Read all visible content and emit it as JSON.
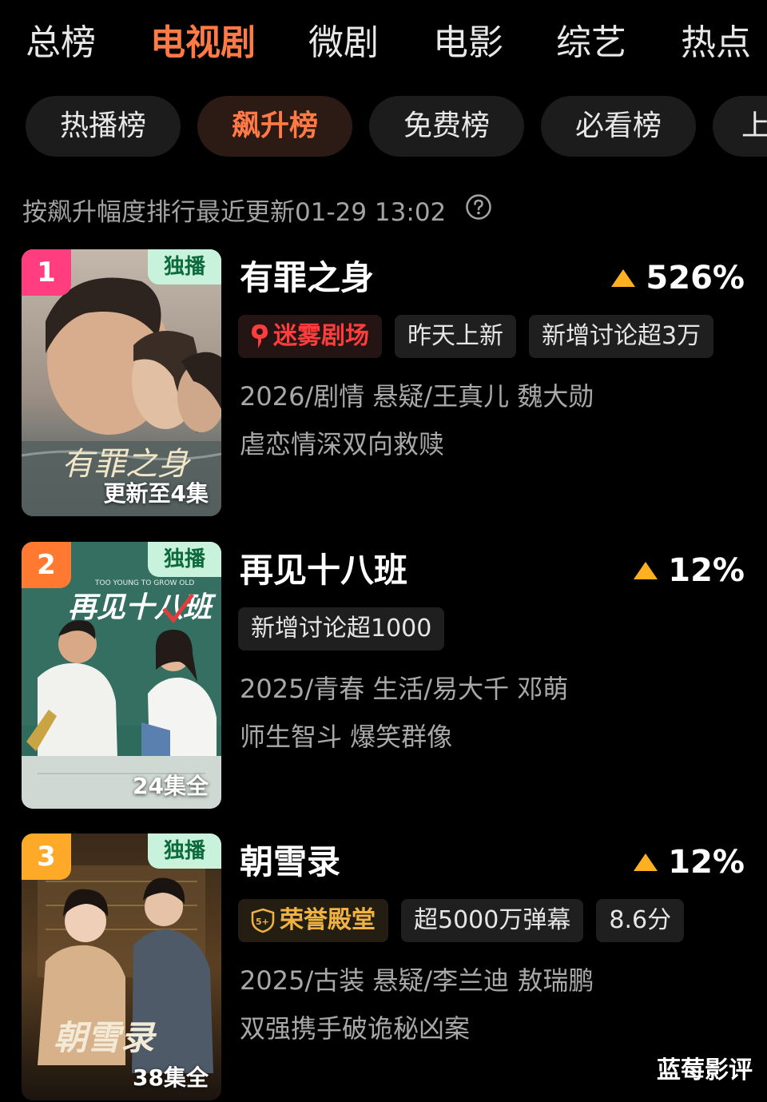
{
  "top_tabs": [
    "总榜",
    "电视剧",
    "微剧",
    "电影",
    "综艺",
    "热点"
  ],
  "active_top_tab": "电视剧",
  "sub_tabs": [
    "热播榜",
    "飙升榜",
    "免费榜",
    "必看榜",
    "上"
  ],
  "active_sub_tab": "飙升榜",
  "hint": "按飙升幅度排行最近更新01-29 13:02",
  "colors": {
    "accent": "#ff7a45",
    "trend_up": "#ffb020",
    "rank1": "#ff3d7f",
    "rank2": "#ff7a30",
    "rank3": "#ffa928",
    "exclusive_bg": "#c9f2dc"
  },
  "items": [
    {
      "rank": "1",
      "exclusive": "独播",
      "episodes": "更新至4集",
      "title": "有罪之身",
      "trend": "526%",
      "tags": [
        "迷雾剧场",
        "昨天上新",
        "新增讨论超3万"
      ],
      "meta": "2026/剧情 悬疑/王真儿 魏大勋",
      "slogan": "虐恋情深双向救赎",
      "poster_text": "有罪之身"
    },
    {
      "rank": "2",
      "exclusive": "独播",
      "episodes": "24集全",
      "title": "再见十八班",
      "trend": "12%",
      "tags": [
        "新增讨论超1000"
      ],
      "meta": "2025/青春 生活/易大千 邓萌",
      "slogan": "师生智斗 爆笑群像",
      "poster_text": "再见十八班",
      "poster_subtext": "TOO YOUNG TO GROW OLD"
    },
    {
      "rank": "3",
      "exclusive": "独播",
      "episodes": "38集全",
      "title": "朝雪录",
      "trend": "12%",
      "tags": [
        "荣誉殿堂",
        "超5000万弹幕",
        "8.6分"
      ],
      "meta": "2025/古装 悬疑/李兰迪 敖瑞鹏",
      "slogan": "双强携手破诡秘凶案",
      "poster_text": "朝雪录"
    }
  ],
  "watermark": "蓝莓影评"
}
